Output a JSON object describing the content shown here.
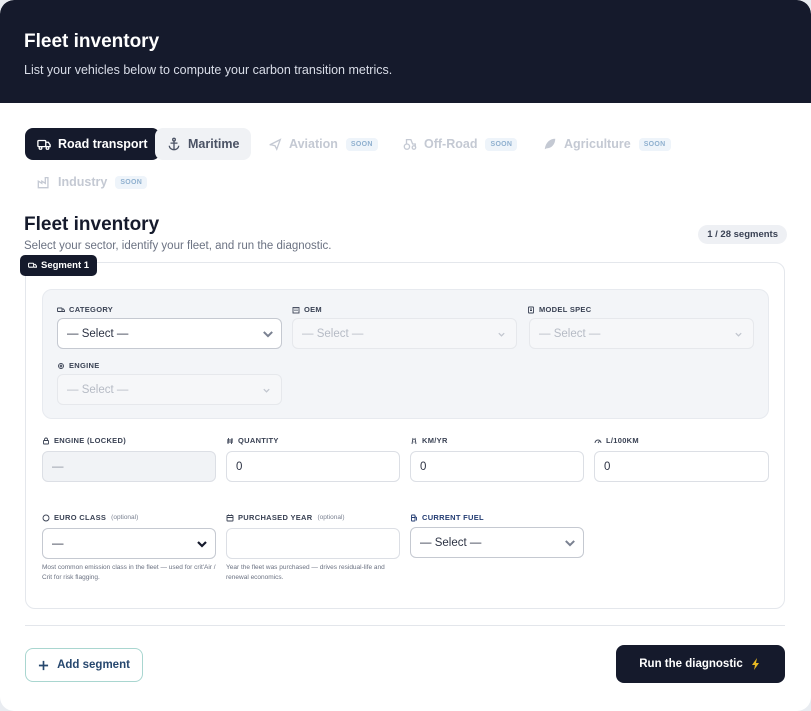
{
  "header": {
    "title": "Fleet inventory",
    "subtitle": "List your vehicles below to compute your carbon transition metrics."
  },
  "tabs": [
    {
      "label": "Road transport",
      "icon": "truck-icon",
      "state": "active"
    },
    {
      "label": "Maritime",
      "icon": "anchor-icon",
      "state": "normal"
    },
    {
      "label": "Aviation",
      "icon": "plane-icon",
      "state": "disabled",
      "badge": "SOON"
    },
    {
      "label": "Off-Road",
      "icon": "tractor-icon",
      "state": "disabled",
      "badge": "SOON"
    },
    {
      "label": "Agriculture",
      "icon": "leaf-icon",
      "state": "disabled",
      "badge": "SOON"
    },
    {
      "label": "Industry",
      "icon": "factory-icon",
      "state": "disabled",
      "badge": "SOON"
    }
  ],
  "section": {
    "title": "Fleet inventory",
    "subtitle": "Select your sector, identify your fleet, and run the diagnostic.",
    "segment_count": "1 / 28 segments"
  },
  "segment": {
    "badge": "Segment 1",
    "category": {
      "label": "CATEGORY",
      "value": "— Select —"
    },
    "oem": {
      "label": "OEM",
      "value": "— Select —"
    },
    "model_spec": {
      "label": "MODEL SPEC",
      "value": "— Select —"
    },
    "engine": {
      "label": "ENGINE",
      "value": "— Select —"
    },
    "engine_locked": {
      "label": "ENGINE (LOCKED)",
      "value": "—"
    },
    "quantity": {
      "label": "QUANTITY",
      "value": "0"
    },
    "km_yr": {
      "label": "KM/YR",
      "value": "0"
    },
    "l_100km": {
      "label": "L/100KM",
      "value": "0"
    },
    "euro_class": {
      "label": "EURO CLASS",
      "optional": "(optional)",
      "value": "—",
      "help": "Most common emission class in the fleet — used for crit'Air / Crit for risk flagging."
    },
    "purchased_year": {
      "label": "PURCHASED YEAR",
      "optional": "(optional)",
      "value": "",
      "help": "Year the fleet was purchased — drives residual-life and renewal economics."
    },
    "current_fuel": {
      "label": "CURRENT FUEL",
      "value": "— Select —"
    }
  },
  "actions": {
    "add_segment": "Add segment",
    "run": "Run the diagnostic"
  },
  "colors": {
    "header_bg": "#151a2c",
    "primary": "#151a2c",
    "add_button_border": "#a9d6d0",
    "soon_badge": "#8fb0cf"
  }
}
